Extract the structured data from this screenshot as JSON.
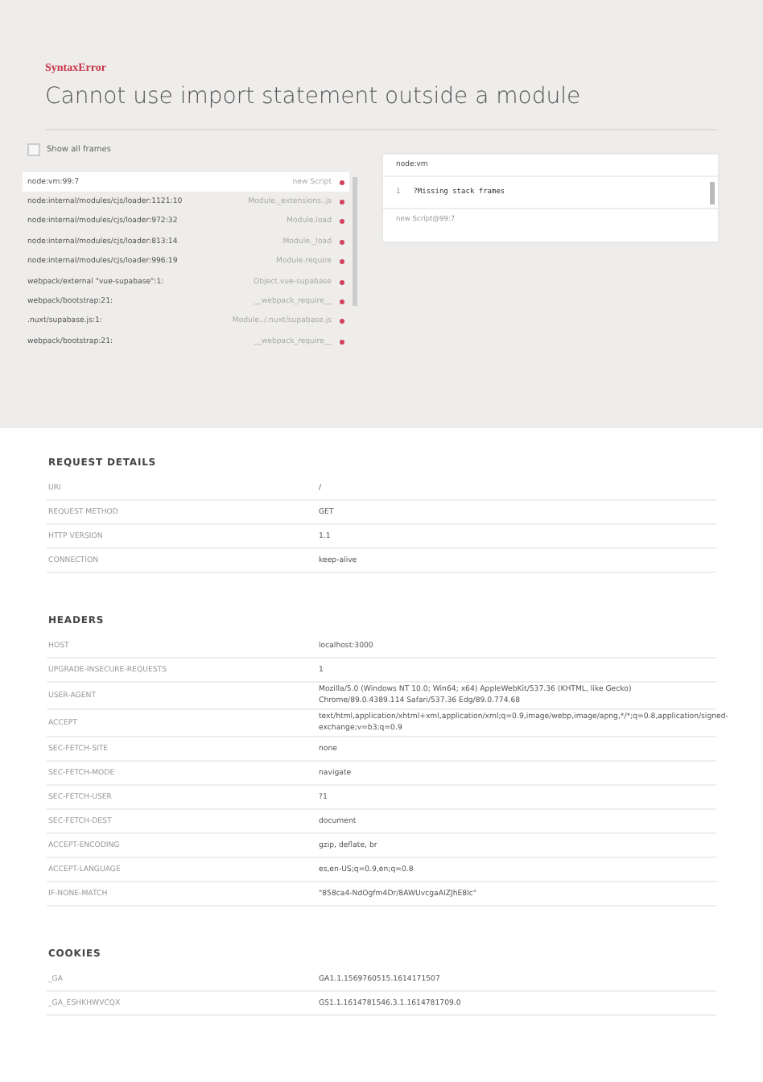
{
  "error": {
    "type": "SyntaxError",
    "message": "Cannot use import statement outside a module"
  },
  "show_all_frames": {
    "label": "Show all frames",
    "checked": false
  },
  "frames": [
    {
      "file": "node:vm:99:7",
      "method": "new Script",
      "selected": true
    },
    {
      "file": "node:internal/modules/cjs/loader:1121:10",
      "method": "Module._extensions..js",
      "selected": false
    },
    {
      "file": "node:internal/modules/cjs/loader:972:32",
      "method": "Module.load",
      "selected": false
    },
    {
      "file": "node:internal/modules/cjs/loader:813:14",
      "method": "Module._load",
      "selected": false
    },
    {
      "file": "node:internal/modules/cjs/loader:996:19",
      "method": "Module.require",
      "selected": false
    },
    {
      "file": "webpack/external \"vue-supabase\":1:",
      "method": "Object.vue-supabase",
      "selected": false
    },
    {
      "file": "webpack/bootstrap:21:",
      "method": "__webpack_require__",
      "selected": false
    },
    {
      "file": ".nuxt/supabase.js:1:",
      "method": "Module../.nuxt/supabase.js",
      "selected": false
    },
    {
      "file": "webpack/bootstrap:21:",
      "method": "__webpack_require__",
      "selected": false
    }
  ],
  "code_panel": {
    "file": "node:vm",
    "line_number": "1",
    "code": "?Missing stack frames",
    "footer": "new Script@99:7"
  },
  "sections": [
    {
      "title": "REQUEST DETAILS",
      "rows": [
        {
          "key": "URI",
          "value": "/"
        },
        {
          "key": "REQUEST METHOD",
          "value": "GET"
        },
        {
          "key": "HTTP VERSION",
          "value": "1.1"
        },
        {
          "key": "CONNECTION",
          "value": "keep-alive"
        }
      ]
    },
    {
      "title": "HEADERS",
      "rows": [
        {
          "key": "HOST",
          "value": "localhost:3000"
        },
        {
          "key": "UPGRADE-INSECURE-REQUESTS",
          "value": "1"
        },
        {
          "key": "USER-AGENT",
          "value": "Mozilla/5.0 (Windows NT 10.0; Win64; x64) AppleWebKit/537.36 (KHTML, like Gecko) Chrome/89.0.4389.114 Safari/537.36 Edg/89.0.774.68"
        },
        {
          "key": "ACCEPT",
          "value": "text/html,application/xhtml+xml,application/xml;q=0.9,image/webp,image/apng,*/*;q=0.8,application/signed-exchange;v=b3;q=0.9"
        },
        {
          "key": "SEC-FETCH-SITE",
          "value": "none"
        },
        {
          "key": "SEC-FETCH-MODE",
          "value": "navigate"
        },
        {
          "key": "SEC-FETCH-USER",
          "value": "?1"
        },
        {
          "key": "SEC-FETCH-DEST",
          "value": "document"
        },
        {
          "key": "ACCEPT-ENCODING",
          "value": "gzip, deflate, br"
        },
        {
          "key": "ACCEPT-LANGUAGE",
          "value": "es,en-US;q=0.9,en;q=0.8"
        },
        {
          "key": "IF-NONE-MATCH",
          "value": "\"858ca4-NdOgfm4Dr/8AWUvcgaAIZJhE8lc\""
        }
      ]
    },
    {
      "title": "COOKIES",
      "rows": [
        {
          "key": "_GA",
          "value": "GA1.1.1569760515.1614171507"
        },
        {
          "key": "_GA_ESHKHWVCQX",
          "value": "GS1.1.1614781546.3.1.1614781709.0"
        }
      ]
    }
  ]
}
